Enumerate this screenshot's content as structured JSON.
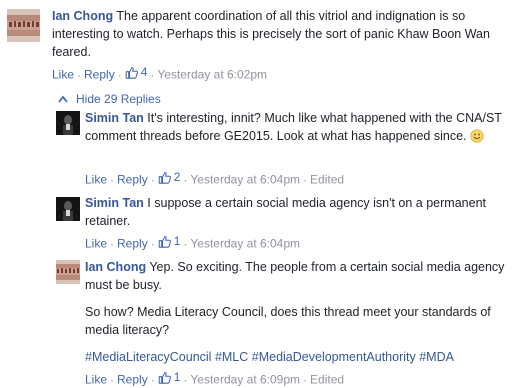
{
  "comments": [
    {
      "author": "Ian Chong",
      "text": "The apparent coordination of all this vitriol and indignation is so interesting to watch. Perhaps this is precisely the sort of panic Khaw Boon Wan feared.",
      "like_label": "Like",
      "reply_label": "Reply",
      "likes": "4",
      "time": "Yesterday at 6:02pm"
    }
  ],
  "hide_replies_label": "Hide 29 Replies",
  "replies": [
    {
      "author": "Simin Tan",
      "text": "It's interesting, innit? Much like what happened with the CNA/ST comment threads before GE2015. Look at what has happened since.",
      "like_label": "Like",
      "reply_label": "Reply",
      "likes": "2",
      "time": "Yesterday at 6:04pm",
      "edited": "Edited"
    },
    {
      "author": "Simin Tan",
      "text": "I suppose a certain social media agency isn't on a permanent retainer.",
      "like_label": "Like",
      "reply_label": "Reply",
      "likes": "1",
      "time": "Yesterday at 6:04pm"
    },
    {
      "author": "Ian Chong",
      "text1": "Yep. So exciting. The people from a certain social media agency must be busy.",
      "text2": "So how? Media Literacy Council, does this thread meet your standards of media literacy?",
      "hashtags": [
        "#MediaLiteracyCouncil",
        "#MLC",
        "#MediaDevelopmentAuthority",
        "#MDA"
      ],
      "like_label": "Like",
      "reply_label": "Reply",
      "likes": "1",
      "time": "Yesterday at 6:09pm",
      "edited": "Edited"
    }
  ],
  "colors": {
    "link": "#365899",
    "action": "#4267b2",
    "meta": "#90949c",
    "text": "#1d2129"
  },
  "icons": {
    "like": "thumbs-up-icon",
    "collapse": "caret-up-icon",
    "emoji": "smiley-emoji-icon"
  }
}
